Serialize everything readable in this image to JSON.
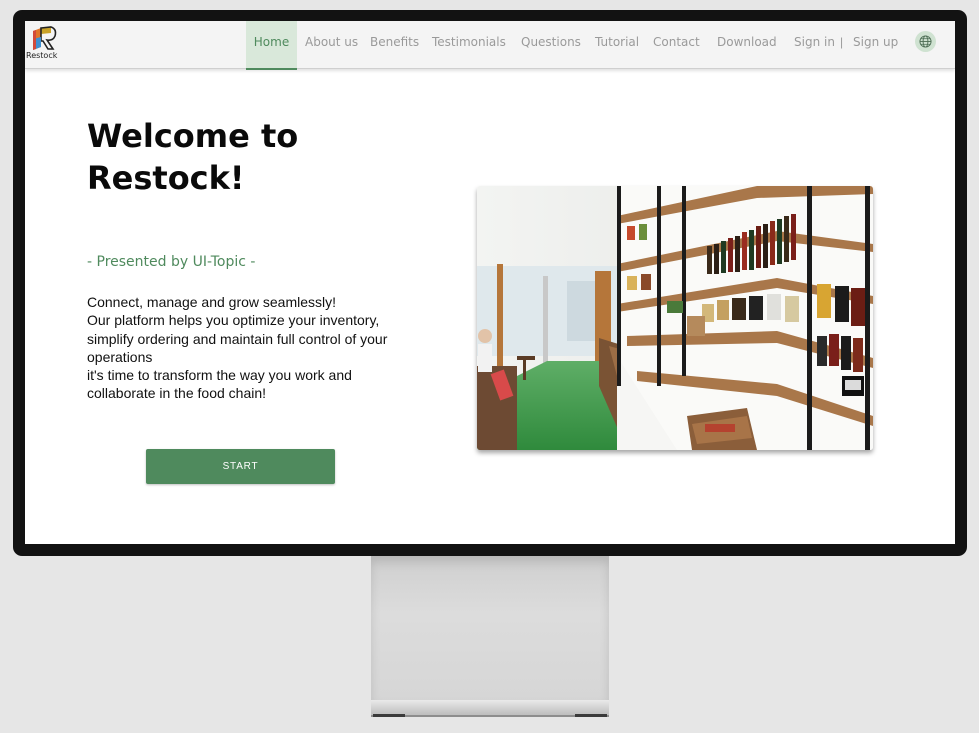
{
  "brand": {
    "name": "Restock",
    "accent": "#4f8a5d"
  },
  "nav": {
    "items": [
      {
        "label": "Home",
        "active": true
      },
      {
        "label": "About us"
      },
      {
        "label": "Benefits"
      },
      {
        "label": "Testimonials"
      },
      {
        "label": "Questions"
      },
      {
        "label": "Tutorial"
      },
      {
        "label": "Contact"
      },
      {
        "label": "Download"
      }
    ],
    "sign_in": "Sign in",
    "separator": "|",
    "sign_up": "Sign up",
    "language_icon": "globe-icon"
  },
  "hero": {
    "title_line1": "Welcome to",
    "title_line2": "Restock!",
    "subtitle": "- Presented by UI-Topic -",
    "body_lines": [
      "Connect, manage and grow seamlessly!",
      "Our platform helps you optimize your inventory,",
      "simplify ordering and maintain full control of your",
      "operations",
      "it's time to transform the way you work and",
      "collaborate in the food chain!"
    ],
    "cta_label": "START",
    "image_alt": "grocery-store-shelves-photo"
  }
}
